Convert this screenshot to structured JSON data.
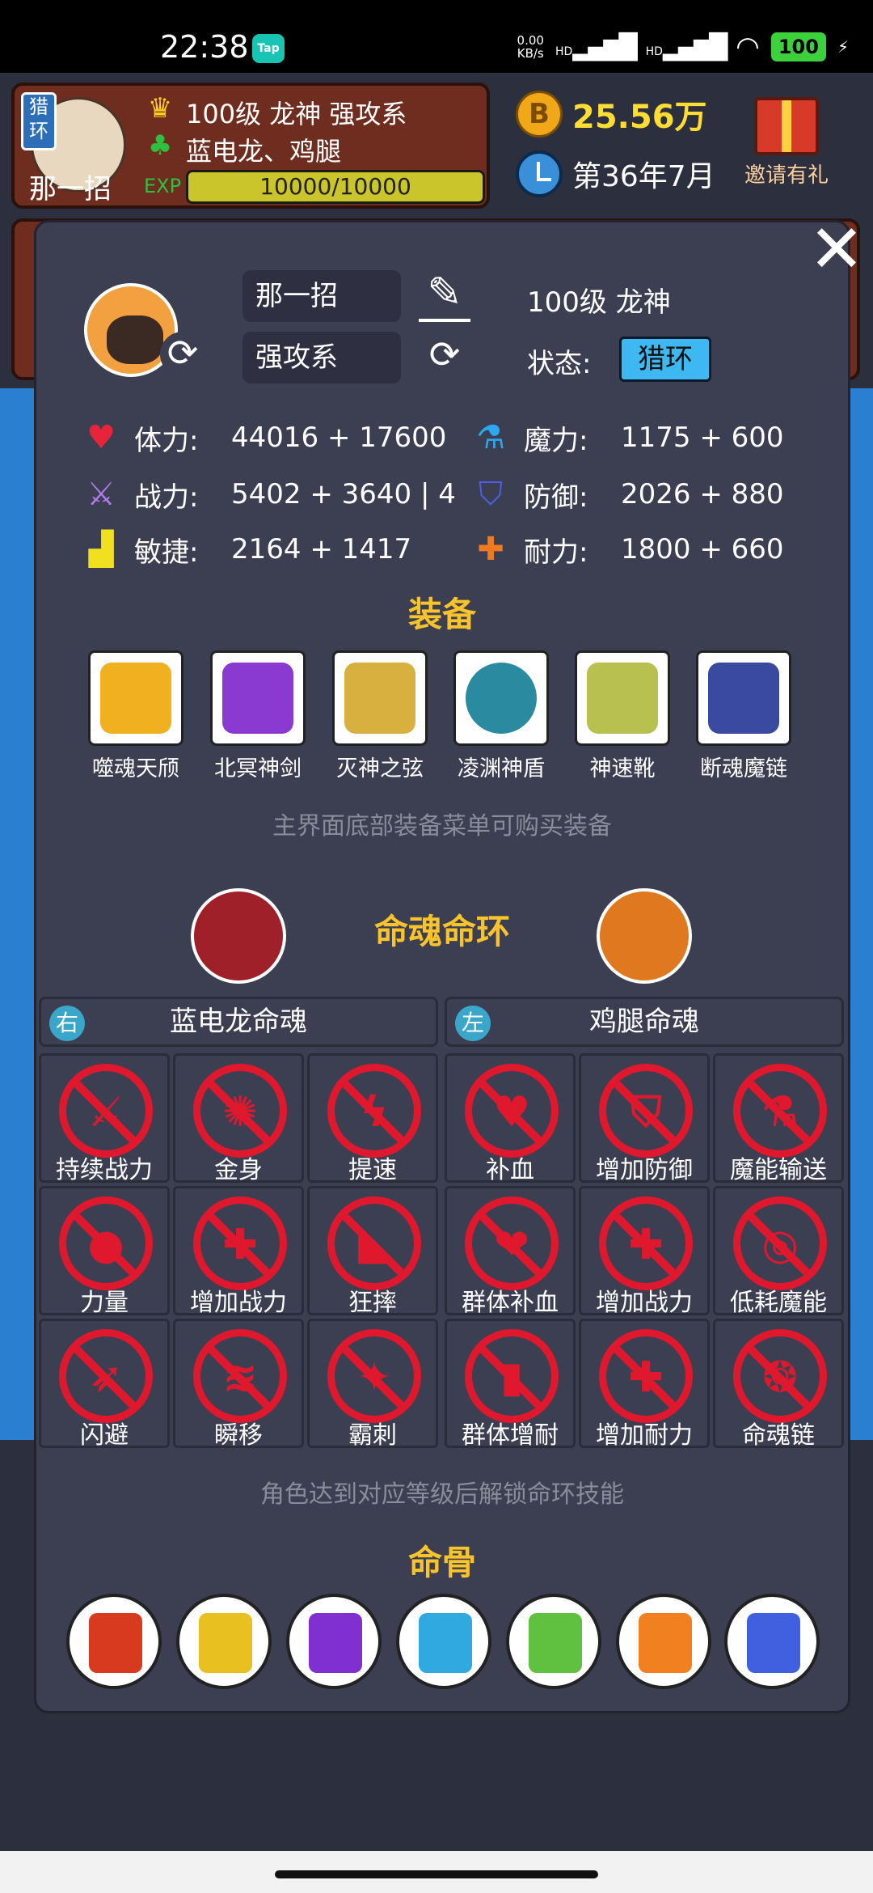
{
  "status_bar": {
    "time": "22:38",
    "tap_badge": "Tap",
    "net_speed": "0.00",
    "net_unit": "KB/s",
    "signal1": "HD",
    "signal2": "HD",
    "battery": "100"
  },
  "header": {
    "tag": "猎环",
    "name": "那一招",
    "line1": "100级 龙神 强攻系",
    "line2": "蓝电龙、鸡腿",
    "xp": "10000/10000",
    "coins": "25.56万",
    "date": "第36年7月",
    "gift_label": "邀请有礼"
  },
  "profile": {
    "name": "那一招",
    "class": "强攻系",
    "level": "100级 龙神",
    "status_label": "状态:",
    "status_value": "猎环"
  },
  "stats": [
    {
      "label": "体力:",
      "value": "44016 + 17600",
      "icon": "heart-icon",
      "color": "#e8243a"
    },
    {
      "label": "魔力:",
      "value": "1175 + 600",
      "icon": "potion-icon",
      "color": "#2ca8f0"
    },
    {
      "label": "战力:",
      "value": "5402 + 3640 | 4",
      "icon": "sword-icon",
      "color": "#b07ce8"
    },
    {
      "label": "防御:",
      "value": "2026 + 880",
      "icon": "shield-icon",
      "color": "#4a60e0"
    },
    {
      "label": "敏捷:",
      "value": "2164 + 1417",
      "icon": "boot-icon",
      "color": "#f0e020"
    },
    {
      "label": "耐力:",
      "value": "1800 + 660",
      "icon": "heart-plus-icon",
      "color": "#f07a20"
    }
  ],
  "equipment": {
    "title": "装备",
    "hint": "主界面底部装备菜单可购买装备",
    "items": [
      {
        "name": "噬魂天颀",
        "color": "#f0b020"
      },
      {
        "name": "北冥神剑",
        "color": "#8a3ad0"
      },
      {
        "name": "灭神之弦",
        "color": "#d8b040"
      },
      {
        "name": "凌渊神盾",
        "color": "#2a8aa0"
      },
      {
        "name": "神速靴",
        "color": "#b8c050"
      },
      {
        "name": "断魂魔链",
        "color": "#3a4aa0"
      }
    ]
  },
  "soul_ring": {
    "title": "命魂命环",
    "right_badge": "右",
    "right_name": "蓝电龙命魂",
    "left_badge": "左",
    "left_name": "鸡腿命魂",
    "right_skills": [
      "持续战力",
      "金身",
      "提速",
      "力量",
      "增加战力",
      "狂摔",
      "闪避",
      "瞬移",
      "霸刺"
    ],
    "left_skills": [
      "补血",
      "增加防御",
      "魔能输送",
      "群体补血",
      "增加战力",
      "低耗魔能",
      "群体增耐",
      "增加耐力",
      "命魂链"
    ],
    "hint": "角色达到对应等级后解锁命环技能"
  },
  "bones": {
    "title": "命骨",
    "colors": [
      "#d83a20",
      "#e8c020",
      "#8030d0",
      "#30a8e0",
      "#60c040",
      "#f08020",
      "#4060e0"
    ]
  },
  "close_label": "✕"
}
